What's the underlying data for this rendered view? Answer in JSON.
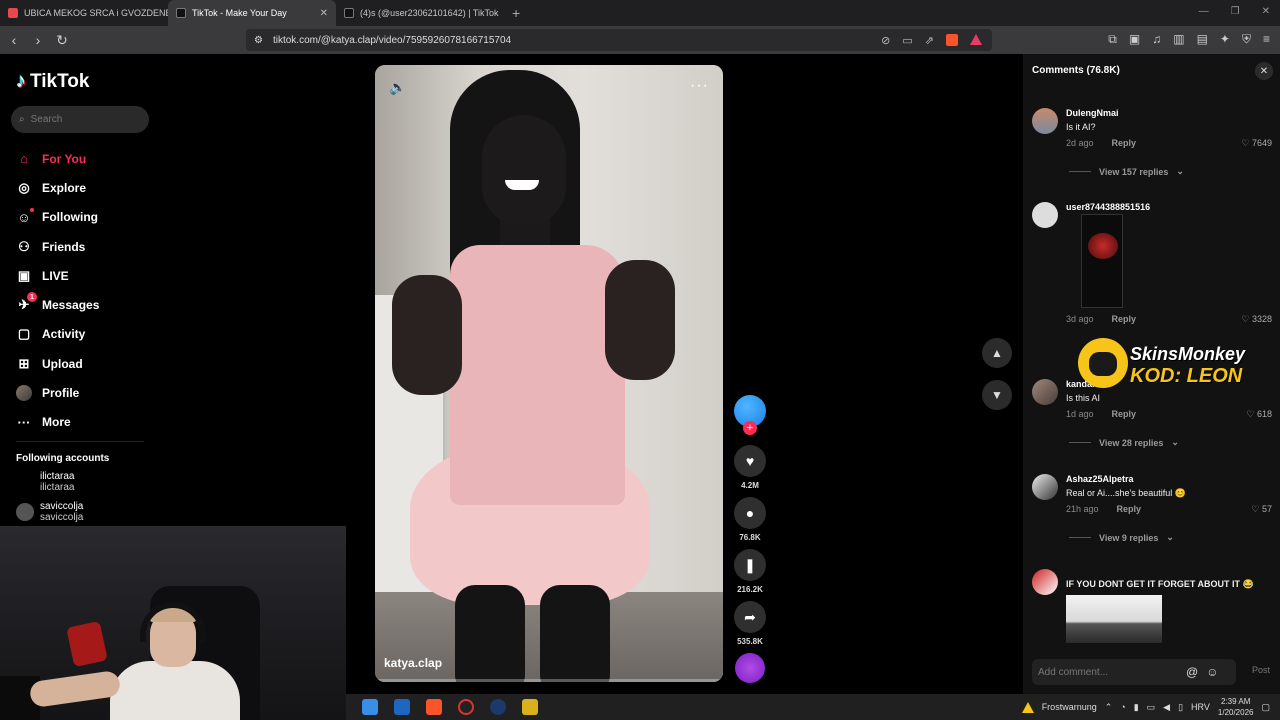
{
  "browser": {
    "tabs": [
      {
        "title": "UBICA MEKOG SRCA i GVOZDENE PESNICE",
        "active": false
      },
      {
        "title": "TikTok - Make Your Day",
        "active": true
      },
      {
        "title": "(4)s (@user23062101642) | TikTok",
        "active": false
      }
    ],
    "url": "tiktok.com/@katya.clap/video/7595926078166715704"
  },
  "sidebar": {
    "logo": "TikTok",
    "search_placeholder": "Search",
    "nav": [
      {
        "label": "For You",
        "icon": "home-icon",
        "glyph": "⌂",
        "active": true
      },
      {
        "label": "Explore",
        "icon": "compass-icon",
        "glyph": "◎"
      },
      {
        "label": "Following",
        "icon": "following-icon",
        "glyph": "☺"
      },
      {
        "label": "Friends",
        "icon": "friends-icon",
        "glyph": "⚇"
      },
      {
        "label": "LIVE",
        "icon": "live-icon",
        "glyph": "▣"
      },
      {
        "label": "Messages",
        "icon": "messages-icon",
        "glyph": "✈",
        "badge": "1"
      },
      {
        "label": "Activity",
        "icon": "activity-icon",
        "glyph": "▢"
      },
      {
        "label": "Upload",
        "icon": "upload-icon",
        "glyph": "⊞"
      },
      {
        "label": "Profile",
        "icon": "profile-avatar",
        "glyph": ""
      },
      {
        "label": "More",
        "icon": "more-icon",
        "glyph": "···"
      }
    ],
    "following_title": "Following accounts",
    "accounts": [
      {
        "name": "ilictaraa",
        "handle": "ilictaraa"
      },
      {
        "name": "saviccolja",
        "handle": "saviccolja"
      }
    ]
  },
  "video": {
    "username": "katya.clap",
    "progress": 0.01,
    "likes": "4.2M",
    "comments": "76.8K",
    "saves": "216.2K",
    "shares": "535.8K"
  },
  "comments_panel": {
    "title": "Comments (76.8K)",
    "items": [
      {
        "user": "DulengNmai",
        "text": "Is it AI?",
        "time": "2d ago",
        "reply": "Reply",
        "likes": "7649",
        "view_replies": "View 157 replies"
      },
      {
        "user": "user8744388851516",
        "text": "",
        "time": "3d ago",
        "reply": "Reply",
        "likes": "3328",
        "view_replies": ""
      },
      {
        "user": "kandar",
        "text": "Is this AI",
        "time": "1d ago",
        "reply": "Reply",
        "likes": "618",
        "view_replies": "View 28 replies"
      },
      {
        "user": "Ashaz25Alpetra",
        "text": "Real or Ai....she's beautiful 😊",
        "time": "21h ago",
        "reply": "Reply",
        "likes": "57",
        "view_replies": "View 9 replies"
      },
      {
        "user": "",
        "text": "IF YOU DONT GET IT FORGET ABOUT IT 😂",
        "time": "",
        "reply": "",
        "likes": "",
        "view_replies": ""
      }
    ],
    "input_placeholder": "Add comment...",
    "post_label": "Post"
  },
  "promo": {
    "line1": "SkinsMonkey",
    "line2": "KOD: LEON"
  },
  "taskbar": {
    "weather": "Frostwarnung",
    "lang": "HRV",
    "time": "2:39 AM",
    "date": "1/20/2026"
  }
}
